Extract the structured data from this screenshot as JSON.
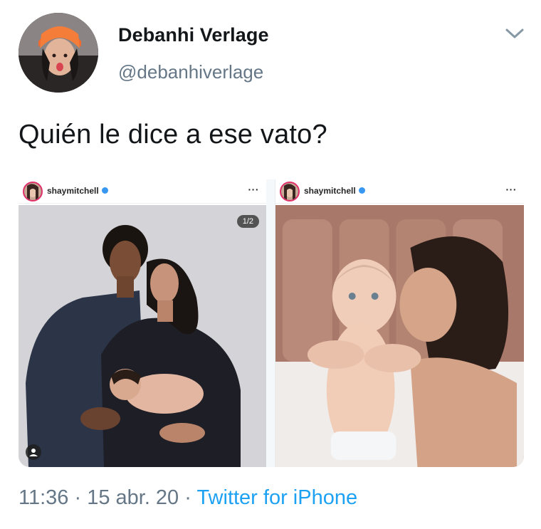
{
  "tweet": {
    "display_name": "Debanhi Verlage",
    "handle": "@debanhiverlage",
    "text": "Quién le dice a ese vato?",
    "timestamp": "11:36 · 15 abr. 20 · ",
    "source": "Twitter for iPhone",
    "menu_icon": "chevron-down-icon"
  },
  "media": {
    "left_post": {
      "username": "shaymitchell",
      "more_label": "···",
      "counter": "1/2"
    },
    "right_post": {
      "username": "shaymitchell",
      "more_label": "···"
    }
  },
  "colors": {
    "text": "#14171a",
    "secondary": "#657786",
    "link": "#1da1f2",
    "verified": "#3897f0"
  }
}
